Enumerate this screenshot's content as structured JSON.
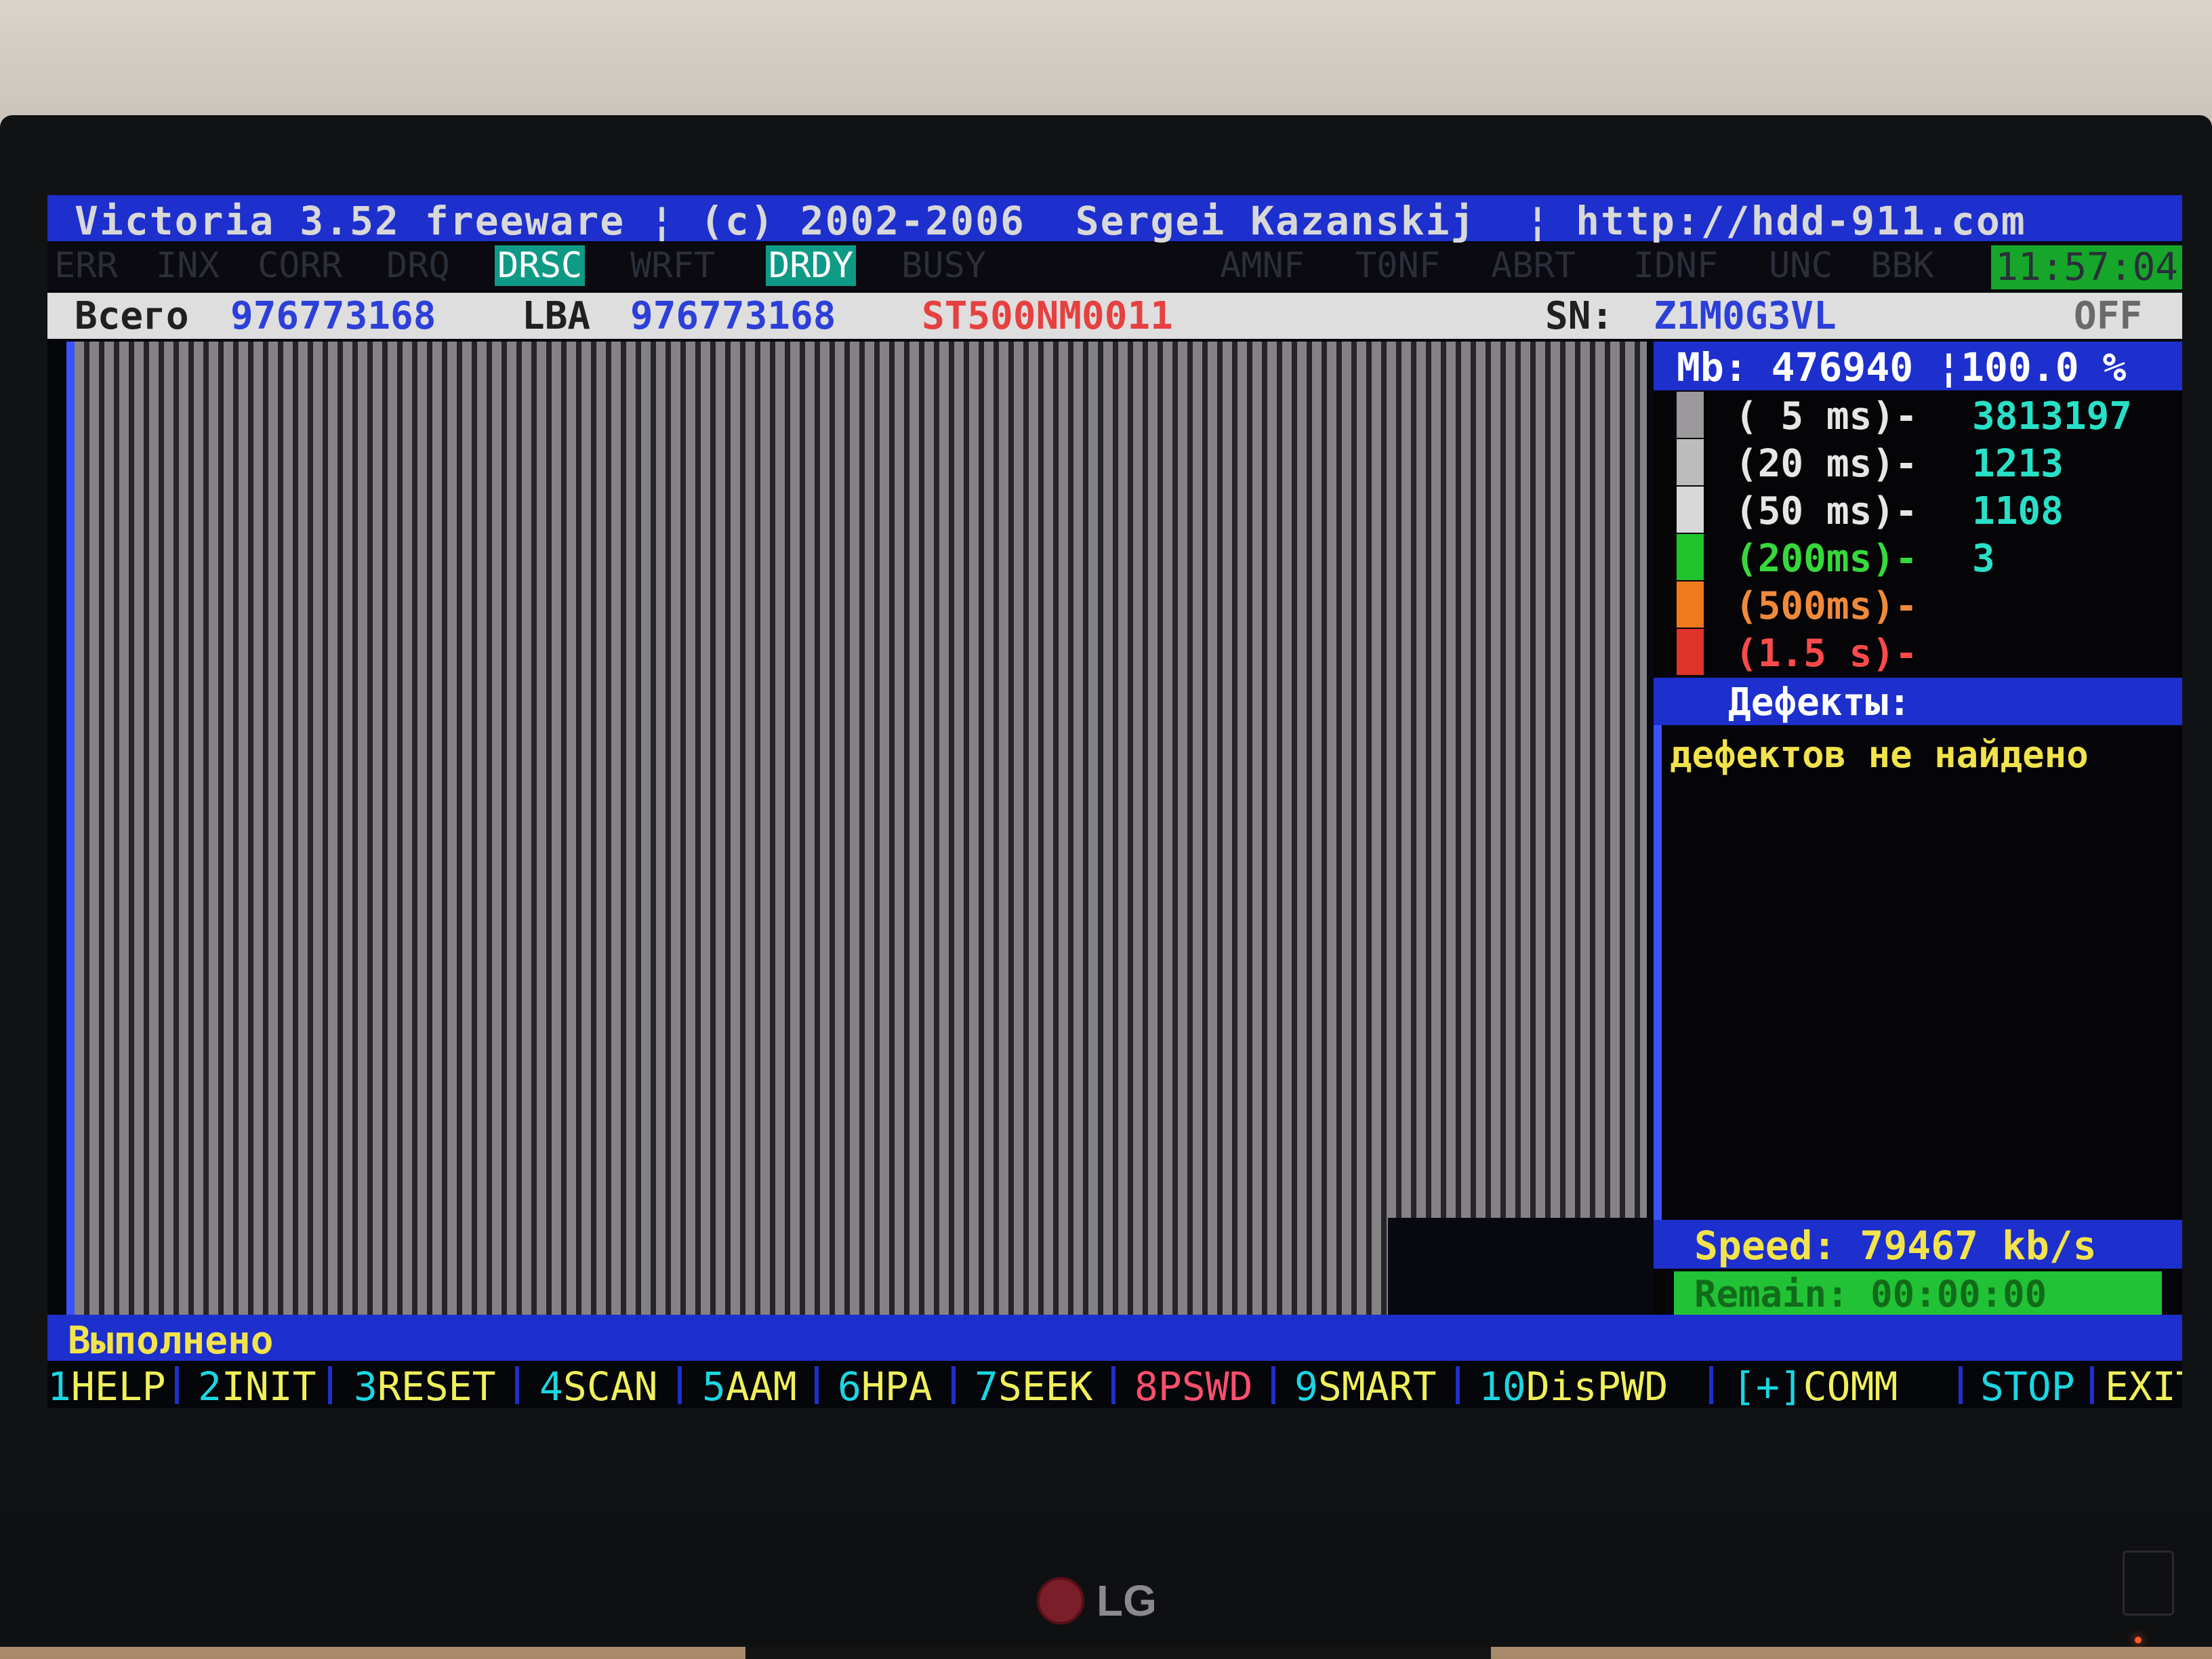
{
  "app": {
    "title": "Victoria 3.52 freeware ¦ (c) 2002-2006  Sergei Kazanskij  ¦ http://hdd-911.com"
  },
  "flags": [
    {
      "label": "ERR",
      "active": false
    },
    {
      "label": "INX",
      "active": false
    },
    {
      "label": "CORR",
      "active": false
    },
    {
      "label": "DRQ",
      "active": false
    },
    {
      "label": "DRSC",
      "active": true
    },
    {
      "label": "WRFT",
      "active": false
    },
    {
      "label": "DRDY",
      "active": true
    },
    {
      "label": "BUSY",
      "active": false
    },
    {
      "label": "AMNF",
      "active": false
    },
    {
      "label": "T0NF",
      "active": false
    },
    {
      "label": "ABRT",
      "active": false
    },
    {
      "label": "IDNF",
      "active": false
    },
    {
      "label": "UNC",
      "active": false
    },
    {
      "label": "BBK",
      "active": false
    }
  ],
  "clock": "11:57:04",
  "info": {
    "total_label": "Всего",
    "total_value": "976773168",
    "lba_label": "LBA",
    "lba_value": "976773168",
    "model": "ST500NM0011",
    "sn_label": "SN:",
    "sn_value": "Z1M0G3VL",
    "off_label": "OFF"
  },
  "side": {
    "mb_text": "Mb: 476940 ¦100.0 %",
    "latency": [
      {
        "label": "( 5 ms)-",
        "count": "3813197",
        "color": "#9c999c",
        "label_color": "#e6e6e6"
      },
      {
        "label": "(20 ms)-",
        "count": "1213",
        "color": "#bcbcbc",
        "label_color": "#e6e6e6"
      },
      {
        "label": "(50 ms)-",
        "count": "1108",
        "color": "#d8d8d8",
        "label_color": "#e6e6e6"
      },
      {
        "label": "(200ms)-",
        "count": "3",
        "color": "#1fc42c",
        "label_color": "#36d93c"
      },
      {
        "label": "(500ms)-",
        "count": "",
        "color": "#ef7a1f",
        "label_color": "#f08a3a"
      },
      {
        "label": "(1.5 s)-",
        "count": "",
        "color": "#e0332b",
        "label_color": "#ff4a4a"
      }
    ],
    "defects_heading": "Дефекты:",
    "defects_text": "дефектов не найдено",
    "speed_text": "Speed: 79467 kb/s",
    "remain_text": "Remain: 00:00:00"
  },
  "status": "Выполнено",
  "function_keys": [
    {
      "num": "1",
      "label": "HELP"
    },
    {
      "num": "2",
      "label": "INIT"
    },
    {
      "num": "3",
      "label": "RESET"
    },
    {
      "num": "4",
      "label": "SCAN"
    },
    {
      "num": "5",
      "label": "AAM"
    },
    {
      "num": "6",
      "label": "HPA"
    },
    {
      "num": "7",
      "label": "SEEK"
    },
    {
      "num": "8",
      "label": "PSWD"
    },
    {
      "num": "9",
      "label": "SMART"
    },
    {
      "num": "10",
      "label": "DisPWD"
    },
    {
      "num": "[+]",
      "label": "COMM"
    },
    {
      "num": "",
      "label": "STOP"
    },
    {
      "num": "",
      "label": "EXIT"
    }
  ],
  "monitor": {
    "brand": "LG"
  },
  "colors": {
    "bar_blue": "#1d2fcc",
    "accent_cyan": "#1bd6e2",
    "accent_yellow": "#f0f05a",
    "model_red": "#e64040",
    "remain_green": "#22c236"
  }
}
